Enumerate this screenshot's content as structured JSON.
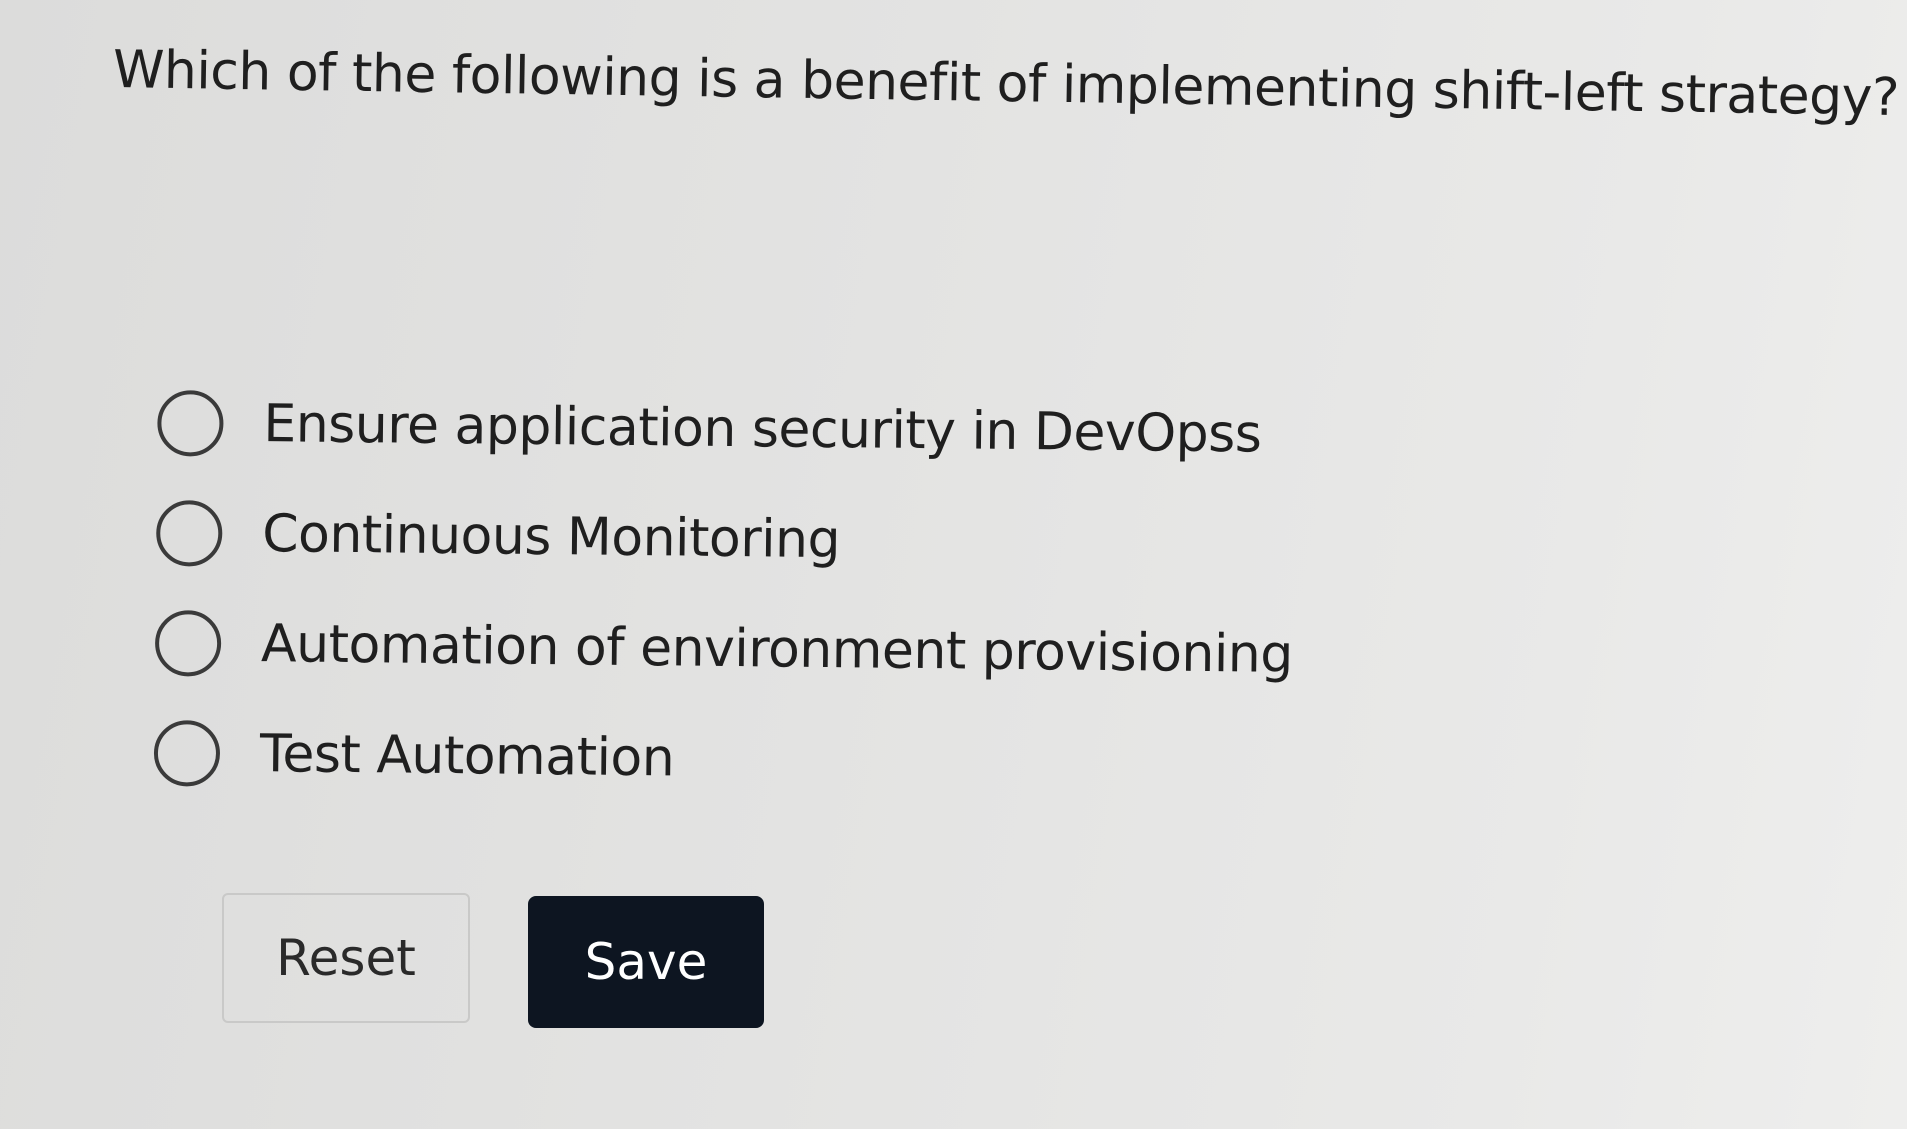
{
  "question": {
    "text": "Which of the following is a benefit of implementing shift-left strategy?"
  },
  "options": [
    {
      "label": "Ensure application security in DevOpss",
      "selected": false
    },
    {
      "label": "Continuous Monitoring",
      "selected": false
    },
    {
      "label": "Automation of environment provisioning",
      "selected": false
    },
    {
      "label": "Test Automation",
      "selected": false
    }
  ],
  "buttons": {
    "reset_label": "Reset",
    "save_label": "Save"
  },
  "colors": {
    "save_button_bg": "#0d1521",
    "radio_border": "#3a3a3a"
  }
}
